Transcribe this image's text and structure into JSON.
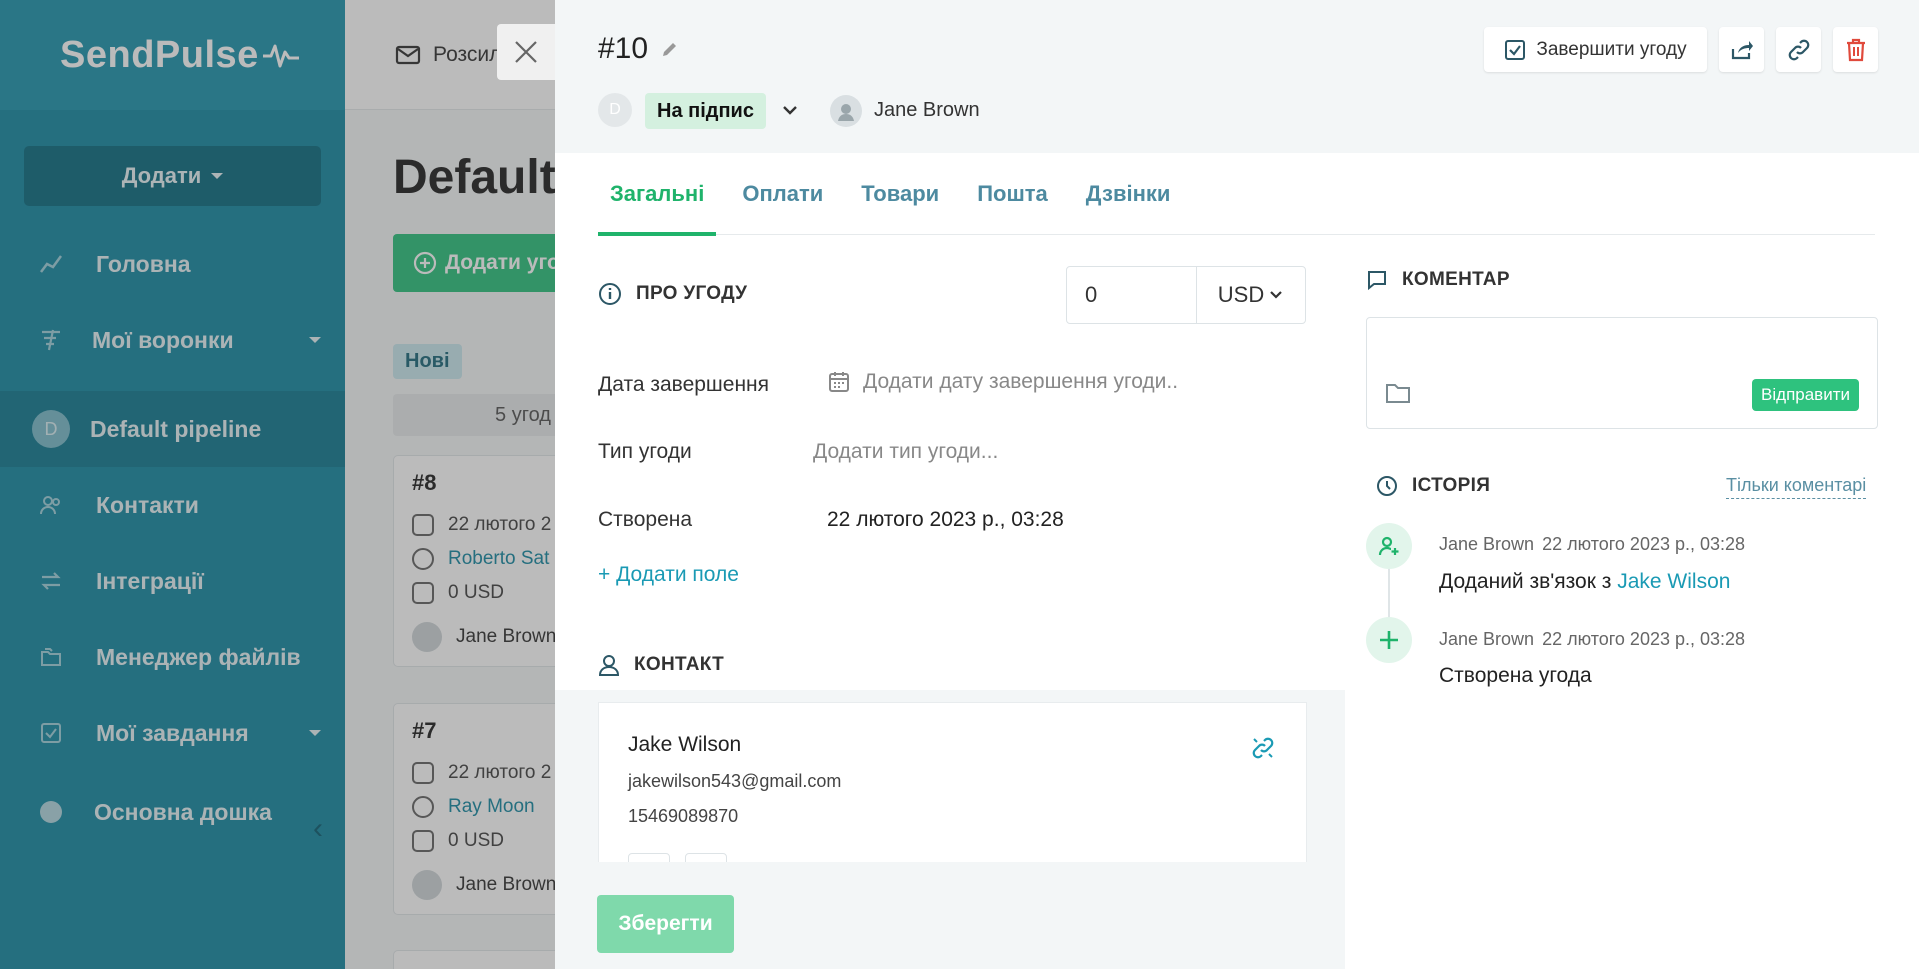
{
  "sidebar": {
    "logo": "SendPulse",
    "add_button": "Додати",
    "items": [
      {
        "label": "Головна"
      },
      {
        "label": "Мої воронки"
      },
      {
        "label": "Default pipeline",
        "avatar": "D"
      },
      {
        "label": "Контакти"
      },
      {
        "label": "Інтеграції"
      },
      {
        "label": "Менеджер файлів"
      },
      {
        "label": "Мої завдання"
      },
      {
        "label": "Основна дошка"
      }
    ]
  },
  "background": {
    "topbar_item": "Розсил",
    "title": "Default",
    "add_deal": "Додати уго",
    "stage": "Нові",
    "count": "5 угод",
    "cards": [
      {
        "num": "#8",
        "date": "22 лютого 2",
        "contact": "Roberto Sat",
        "amount": "0 USD",
        "owner": "Jane Brown"
      },
      {
        "num": "#7",
        "date": "22 лютого 2",
        "contact": "Ray Moon",
        "amount": "0 USD",
        "owner": "Jane Brown"
      }
    ]
  },
  "deal": {
    "title": "#10",
    "stage_avatar": "D",
    "stage": "На підпис",
    "owner": "Jane Brown",
    "finish_button": "Завершити угоду",
    "tabs": [
      "Загальні",
      "Оплати",
      "Товари",
      "Пошта",
      "Дзвінки"
    ],
    "about": {
      "title": "ПРО УГОДУ",
      "amount": "0",
      "currency": "USD",
      "fields": [
        {
          "label": "Дата завершення",
          "value": "Додати дату завершення угоди.."
        },
        {
          "label": "Тип угоди",
          "value": "Додати тип угоди..."
        },
        {
          "label": "Створена",
          "value": "22 лютого 2023 р., 03:28"
        }
      ],
      "add_field": "+ Додати поле"
    },
    "contact": {
      "title": "КОНТАКТ",
      "name": "Jake Wilson",
      "email": "jakewilson543@gmail.com",
      "phone": "15469089870"
    },
    "save_button": "Зберегти",
    "comment": {
      "title": "КОМЕНТАР",
      "send_button": "Відправити"
    },
    "history": {
      "title": "ІСТОРІЯ",
      "filter": "Тільки коментарі",
      "entries": [
        {
          "author": "Jane Brown",
          "time": "22 лютого 2023 р., 03:28",
          "text": "Доданий зв'язок з ",
          "link": "Jake Wilson"
        },
        {
          "author": "Jane Brown",
          "time": "22 лютого 2023 р., 03:28",
          "text": "Створена угода"
        }
      ]
    }
  },
  "colors": {
    "sidebar": "#1a8aa3",
    "accent_green": "#1fb36b",
    "link": "#1a9ab4",
    "danger": "#e04a3c"
  }
}
